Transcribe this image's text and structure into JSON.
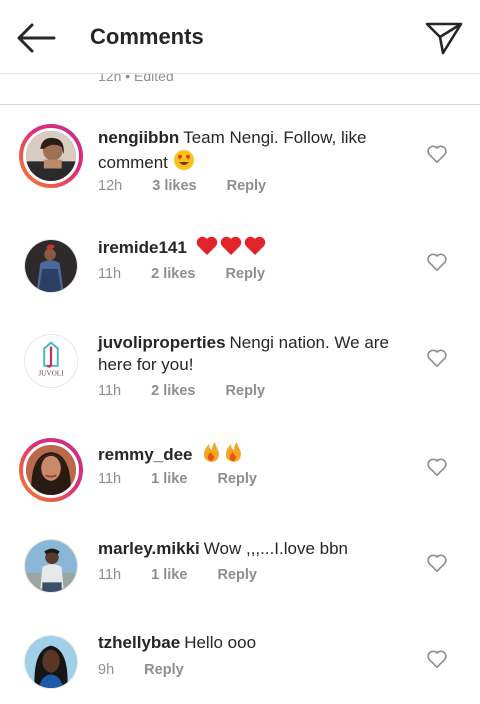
{
  "header": {
    "title": "Comments"
  },
  "previous_meta": "12h • Edited",
  "comments": [
    {
      "username": "nengiibbn",
      "text": "Team Nengi. Follow, like comment",
      "time": "12h",
      "likes": "3 likes",
      "reply": "Reply"
    },
    {
      "username": "iremide141",
      "text": "",
      "time": "11h",
      "likes": "2 likes",
      "reply": "Reply"
    },
    {
      "username": "juvoliproperties",
      "text": "Nengi nation. We are here for you!",
      "time": "11h",
      "likes": "2 likes",
      "reply": "Reply",
      "avatar_text": "JUVOLI"
    },
    {
      "username": "remmy_dee",
      "text": "",
      "time": "11h",
      "likes": "1 like",
      "reply": "Reply"
    },
    {
      "username": "marley.mikki",
      "text": "Wow ,,,...I.love bbn",
      "time": "11h",
      "likes": "1 like",
      "reply": "Reply"
    },
    {
      "username": "tzhellybae",
      "text": "Hello ooo",
      "time": "9h",
      "reply": "Reply"
    }
  ],
  "colors": {
    "muted": "#8e8e8e",
    "text": "#262626",
    "heart_emoji": "#e0242a",
    "fire": "#f5a623",
    "story_ring": "#dd2a7b"
  }
}
